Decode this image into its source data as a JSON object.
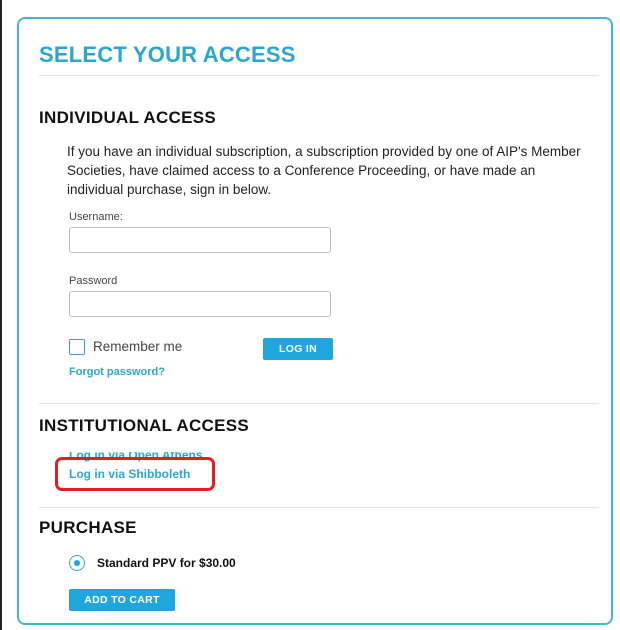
{
  "page": {
    "title": "SELECT YOUR ACCESS"
  },
  "individual": {
    "heading": "INDIVIDUAL ACCESS",
    "intro": "If you have an individual subscription, a subscription provided by one of AIP's Member Societies, have claimed access to a Conference Proceeding, or have made an individual purchase, sign in below.",
    "username_label": "Username:",
    "username_value": "",
    "password_label": "Password",
    "password_value": "",
    "remember_label": "Remember me",
    "remember_checked": false,
    "login_button": "LOG IN",
    "forgot_link": "Forgot password?"
  },
  "institutional": {
    "heading": "INSTITUTIONAL ACCESS",
    "open_athens_link": "Log in via Open Athens",
    "shibboleth_link": "Log in via Shibboleth"
  },
  "purchase": {
    "heading": "PURCHASE",
    "option_label": "Standard PPV for $30.00",
    "option_selected": true,
    "cart_button": "ADD TO CART"
  },
  "colors": {
    "accent": "#2aa6cf",
    "button": "#1fa7dd",
    "highlight": "#e21f1f"
  }
}
